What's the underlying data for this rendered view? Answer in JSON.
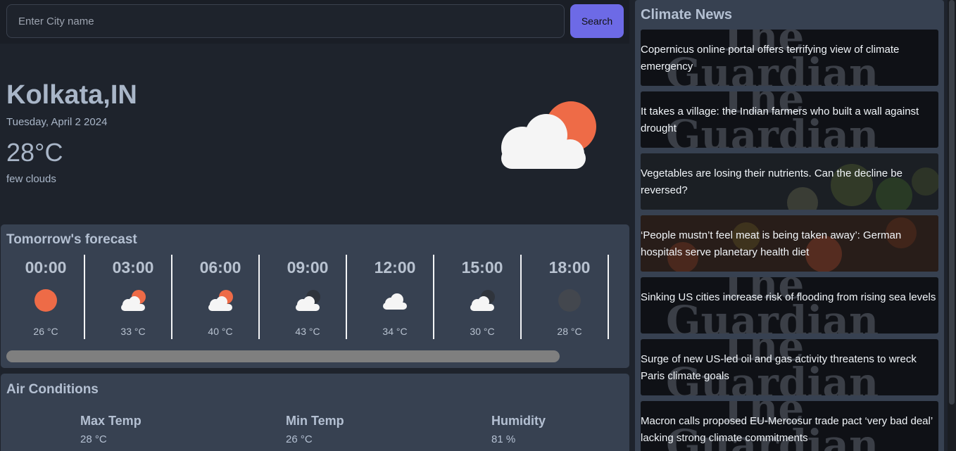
{
  "search": {
    "placeholder": "Enter City name",
    "button_label": "Search"
  },
  "current": {
    "city": "Kolkata,IN",
    "date": "Tuesday, April 2 2024",
    "temperature": "28°C",
    "description": "few clouds",
    "icon": "few-clouds-day-icon"
  },
  "forecast": {
    "title": "Tomorrow's forecast",
    "items": [
      {
        "time": "00:00",
        "temp": "26 °C",
        "icon": "sun-icon"
      },
      {
        "time": "03:00",
        "temp": "33 °C",
        "icon": "cloud-sun-icon"
      },
      {
        "time": "06:00",
        "temp": "40 °C",
        "icon": "cloud-sun-icon"
      },
      {
        "time": "09:00",
        "temp": "43 °C",
        "icon": "cloud-moon-icon"
      },
      {
        "time": "12:00",
        "temp": "34 °C",
        "icon": "cloud-icon"
      },
      {
        "time": "15:00",
        "temp": "30 °C",
        "icon": "cloud-moon-icon"
      },
      {
        "time": "18:00",
        "temp": "28 °C",
        "icon": "moon-icon"
      }
    ]
  },
  "air": {
    "title": "Air Conditions",
    "items": [
      {
        "label": "Max Temp",
        "value": "28 °C"
      },
      {
        "label": "Min Temp",
        "value": "26 °C"
      },
      {
        "label": "Humidity",
        "value": "81 %"
      }
    ]
  },
  "news": {
    "title": "Climate News",
    "watermark": "The Guardian",
    "items": [
      {
        "headline": "Copernicus online portal offers terrifying view of climate emergency",
        "image": "guardian-logo"
      },
      {
        "headline": "It takes a village: the Indian farmers who built a wall against drought",
        "image": "guardian-logo"
      },
      {
        "headline": "Vegetables are losing their nutrients. Can the decline be reversed?",
        "image": "vegetables-photo"
      },
      {
        "headline": "‘People mustn’t feel meat is being taken away’: German hospitals serve planetary health diet",
        "image": "food-photo"
      },
      {
        "headline": "Sinking US cities increase risk of flooding from rising sea levels",
        "image": "guardian-logo"
      },
      {
        "headline": "Surge of new US-led oil and gas activity threatens to wreck Paris climate goals",
        "image": "guardian-logo"
      },
      {
        "headline": "Macron calls proposed EU-Mercosur trade pact ‘very bad deal’ lacking strong climate commitments",
        "image": "guardian-logo"
      }
    ]
  },
  "colors": {
    "accent": "#6d6ae6",
    "sun": "#ee6b47",
    "panel": "#374151",
    "background": "#1e232c"
  }
}
